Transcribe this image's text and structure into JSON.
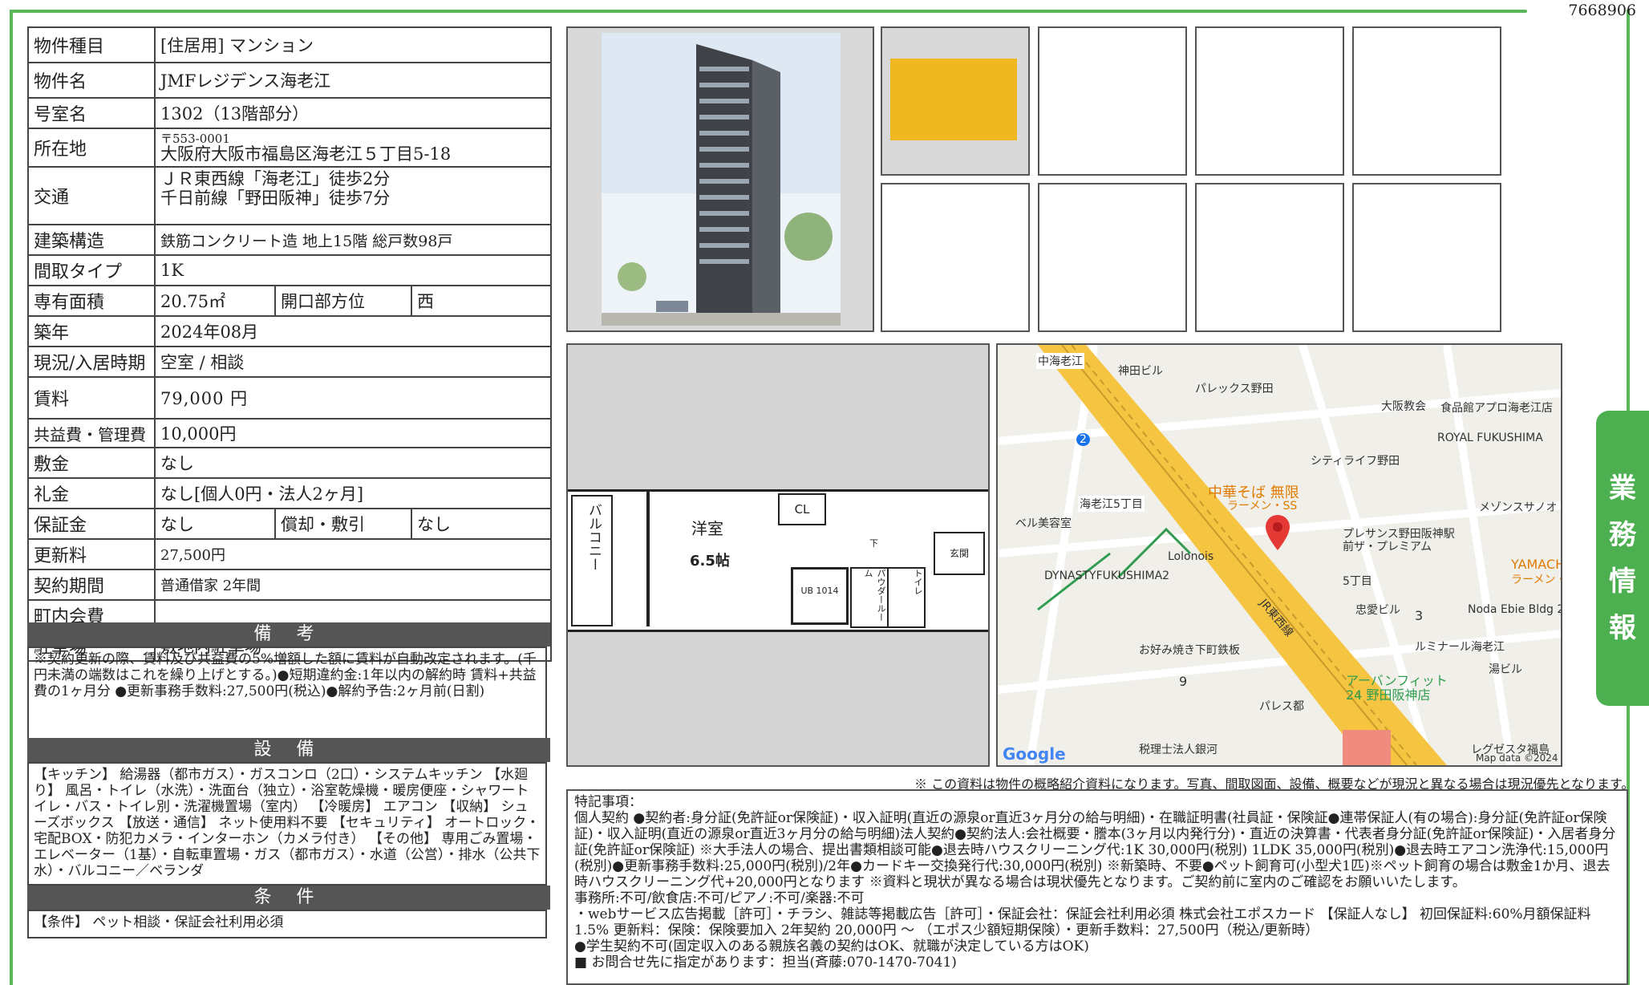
{
  "doc_number": "7668906",
  "side_tab": [
    "業",
    "務",
    "情",
    "報"
  ],
  "spec": {
    "type_label": "物件種目",
    "type_value": "[住居用] マンション",
    "name_label": "物件名",
    "name_value": "JMFレジデンス海老江",
    "room_label": "号室名",
    "room_value": "1302（13階部分）",
    "address_label": "所在地",
    "postal": "〒553-0001",
    "address": "大阪府大阪市福島区海老江５丁目5-18",
    "traffic_label": "交通",
    "traffic_1": "ＪＲ東西線「海老江」徒歩2分",
    "traffic_2": "千日前線「野田阪神」徒歩7分",
    "structure_label": "建築構造",
    "structure_value": "鉄筋コンクリート造 地上15階 総戸数98戸",
    "layout_label": "間取タイプ",
    "layout_value": "1K",
    "area_label": "専有面積",
    "area_value": "20.75㎡",
    "direction_label": "開口部方位",
    "direction_value": "西",
    "built_label": "築年",
    "built_value": "2024年08月",
    "status_label": "現況/入居時期",
    "status_value": "空室 / 相談",
    "rent_label": "賃料",
    "rent_value": "79,000 円",
    "fee_label": "共益費・管理費",
    "fee_value": "10,000円",
    "deposit_label": "敷金",
    "deposit_value": "なし",
    "key_label": "礼金",
    "key_value": "なし[個人0円・法人2ヶ月]",
    "guarantee_label": "保証金",
    "guarantee_value": "なし",
    "amort_label": "償却・敷引",
    "amort_value": "なし",
    "renew_label": "更新料",
    "renew_value": "27,500円",
    "contract_label": "契約期間",
    "contract_value": "普通借家 2年間",
    "town_label": "町内会費",
    "town_value": "",
    "parking_label": "駐車場",
    "parking_value": "敷地内駐車場"
  },
  "remarks": {
    "title": "備 考",
    "text": "※契約更新の際、賃料及び共益費の5%増額した額に賃料が自動改定されます。(千円未満の端数はこれを繰り上げとする。)●短期違約金:1年以内の解約時 賃料+共益費の1ヶ月分 ●更新事務手数料:27,500円(税込)●解約予告:2ヶ月前(日割)"
  },
  "facilities": {
    "title": "設 備",
    "text": "【キッチン】 給湯器（都市ガス）・ガスコンロ（2口）・システムキッチン 【水廻り】 風呂・トイレ（水洗）・洗面台（独立）・浴室乾燥機・暖房便座・シャワートイレ・バス・トイレ別・洗濯機置場（室内） 【冷暖房】 エアコン 【収納】 シューズボックス 【放送・通信】 ネット使用料不要 【セキュリティ】 オートロック・宅配BOX・防犯カメラ・インターホン（カメラ付き） 【その他】 専用ごみ置場・エレベーター（1基）・自転車置場・ガス（都市ガス）・水道（公営）・排水（公共下水）・バルコニー／ベランダ"
  },
  "conditions": {
    "title": "条 件",
    "text": "【条件】 ペット相談・保証会社利用必須"
  },
  "floorplan": {
    "balcony": "バルコニー",
    "room": "洋室",
    "size": "6.5帖",
    "cl": "CL",
    "ub": "UB 1014",
    "powder": "パウダールーム",
    "toilet": "トイレ",
    "entrance": "玄関",
    "shoebox": "下"
  },
  "map": {
    "labels": [
      "中海老江",
      "神田ビル",
      "パレックス野田",
      "大阪教会",
      "食品館アプロ海老江店",
      "ROYAL FUKUSHIMA",
      "シティライフ野田",
      "中華そば 無限",
      "ラーメン・SS",
      "メゾンスサノオ",
      "海老江5丁目",
      "ベル美容室",
      "プレサンス野田阪神駅前ザ・プレミアム",
      "Lolonois",
      "DYNASTYFUKUSHIMA2",
      "5丁目",
      "YAMACHAN",
      "ラーメン・",
      "忠愛ビル",
      "Noda Ebie Bldg 2",
      "お好み焼き下町鉄板",
      "ルミナール海老江",
      "湯ビル",
      "JR東西線",
      "パレス都",
      "アーバンフィット24 野田阪神店",
      "税理士法人銀河",
      "レグゼスタ福島",
      "Map data ©2024",
      "Google",
      "3",
      "9",
      "2"
    ]
  },
  "disclaimer": "※ この資料は物件の概略紹介資料になります。写真、間取図面、設備、概要などが現況と異なる場合は現況優先となります。",
  "special": {
    "title": "特記事項：",
    "line1": "個人契約 ●契約者:身分証(免許証or保険証)・収入証明(直近の源泉or直近3ヶ月分の給与明細)・在職証明書(社員証・保険証●連帯保証人(有の場合):身分証(免許証or保険証)・収入証明(直近の源泉or直近3ヶ月分の給与明細)法人契約●契約法人:会社概要・謄本(3ヶ月以内発行分)・直近の決算書・代表者身分証(免許証or保険証)・入居者身分証(免許証or保険証) ※大手法人の場合、提出書類相談可能●退去時ハウスクリーニング代:1K 30,000円(税別) 1LDK 35,000円(税別)●退去時エアコン洗浄代:15,000円(税別)●更新事務手数料:25,000円(税別)/2年●カードキー交換発行代:30,000円(税別) ※新築時、不要●ペット飼育可(小型犬1匹)※ペット飼育の場合は敷金1か月、退去時ハウスクリーニング代+20,000円となります ※資料と現状が異なる場合は現状優先となります。ご契約前に室内のご確認をお願いいたします。",
    "line2": "事務所:不可/飲食店:不可/ピアノ:不可/楽器:不可",
    "line3": "・webサービス広告掲載［許可］・チラシ、雑誌等掲載広告［許可］・保証会社：保証会社利用必須 株式会社エポスカード 【保証人なし】 初回保証料:60%月額保証料1.5% 更新料：保険：保険要加入 2年契約 20,000円 〜 （エポス少額短期保険）・更新手数料：27,500円（税込/更新時）",
    "line4": "●学生契約不可(固定収入のある親族名義の契約はOK、就職が決定している方はOK)",
    "line5": "■ お問合せ先に指定があります：担当(斉藤:070-1470-7041)"
  }
}
